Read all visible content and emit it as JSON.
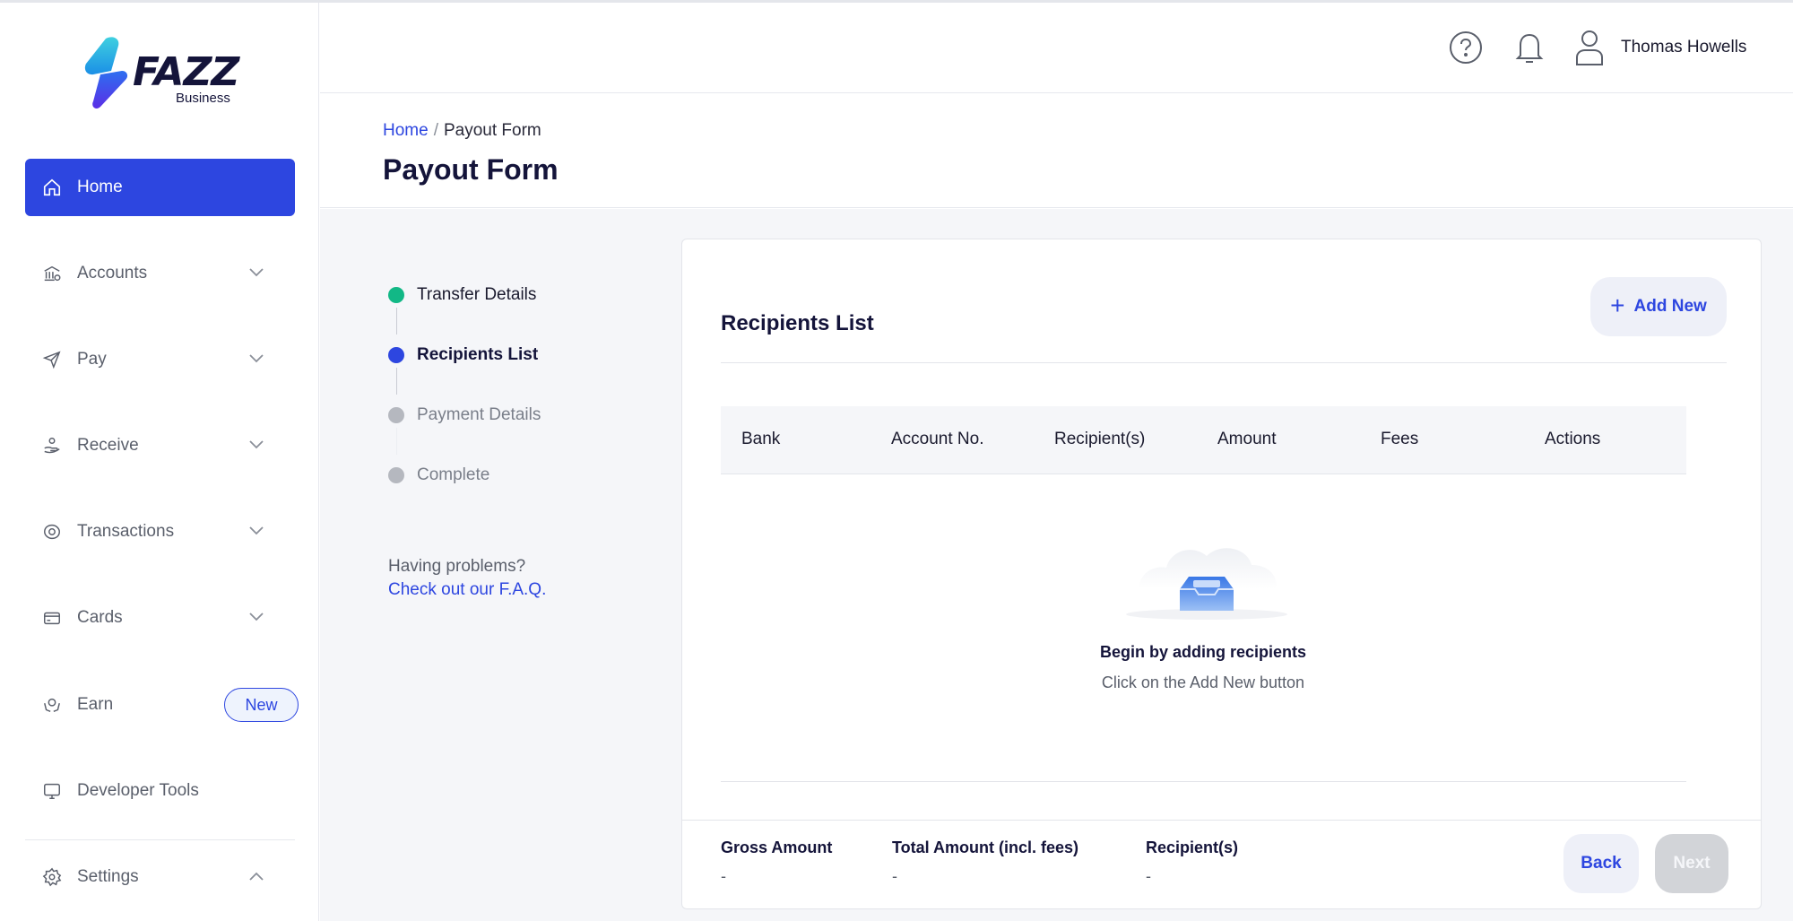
{
  "brand": {
    "name": "FAZZ",
    "sub": "Business"
  },
  "header": {
    "user_name": "Thomas Howells",
    "icons": [
      "help-icon",
      "bell-icon",
      "user-icon"
    ]
  },
  "sidebar": {
    "items": [
      {
        "label": "Home",
        "icon": "home-icon",
        "active": true
      },
      {
        "label": "Accounts",
        "icon": "bank-icon",
        "expandable": true
      },
      {
        "label": "Pay",
        "icon": "send-icon",
        "expandable": true
      },
      {
        "label": "Receive",
        "icon": "receive-icon",
        "expandable": true
      },
      {
        "label": "Transactions",
        "icon": "transactions-icon",
        "expandable": true
      },
      {
        "label": "Cards",
        "icon": "card-icon",
        "expandable": true
      },
      {
        "label": "Earn",
        "icon": "earn-icon",
        "badge": "New"
      },
      {
        "label": "Developer Tools",
        "icon": "monitor-icon"
      },
      {
        "label": "Settings",
        "icon": "gear-icon",
        "expanded": true
      }
    ]
  },
  "breadcrumb": {
    "home": "Home",
    "separator": "/",
    "current": "Payout Form"
  },
  "page_title": "Payout Form",
  "stepper": {
    "steps": [
      {
        "label": "Transfer Details",
        "state": "done"
      },
      {
        "label": "Recipients List",
        "state": "current"
      },
      {
        "label": "Payment Details",
        "state": "pending"
      },
      {
        "label": "Complete",
        "state": "pending"
      }
    ]
  },
  "help": {
    "text": "Having problems?",
    "link": "Check out our F.A.Q."
  },
  "card": {
    "title": "Recipients List",
    "add_new": "Add New",
    "columns": [
      "Bank",
      "Account No.",
      "Recipient(s)",
      "Amount",
      "Fees",
      "Actions"
    ],
    "empty_title": "Begin by adding recipients",
    "empty_sub": "Click on the Add New button"
  },
  "footer": {
    "gross_label": "Gross Amount",
    "gross_value": "-",
    "total_label": "Total Amount (incl. fees)",
    "total_value": "-",
    "recipients_label": "Recipient(s)",
    "recipients_value": "-",
    "back": "Back",
    "next": "Next"
  },
  "colors": {
    "primary": "#2d46e0",
    "done": "#12b886",
    "pending": "#b5b8bf",
    "disabled": "#d2d4d8"
  }
}
